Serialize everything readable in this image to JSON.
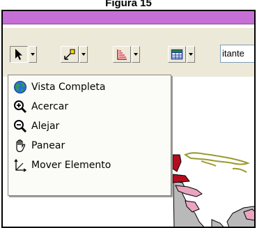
{
  "caption": "Figura 15",
  "toolbar": {
    "field_text": "itante"
  },
  "menu": {
    "items": [
      {
        "label": "Vista Completa",
        "icon": "globe-icon"
      },
      {
        "label": "Acercar",
        "icon": "zoom-in-icon"
      },
      {
        "label": "Alejar",
        "icon": "zoom-out-icon"
      },
      {
        "label": "Panear",
        "icon": "pan-hand-icon"
      },
      {
        "label": "Mover Elemento",
        "icon": "move-arrows-icon"
      }
    ]
  },
  "colors": {
    "titlebar": "#c66fd6",
    "toolbar": "#ece9d8",
    "map_land_pink": "#e9a5bf",
    "map_land_gray": "#b9b9b9",
    "map_outline_olive": "#9a9a2e"
  }
}
